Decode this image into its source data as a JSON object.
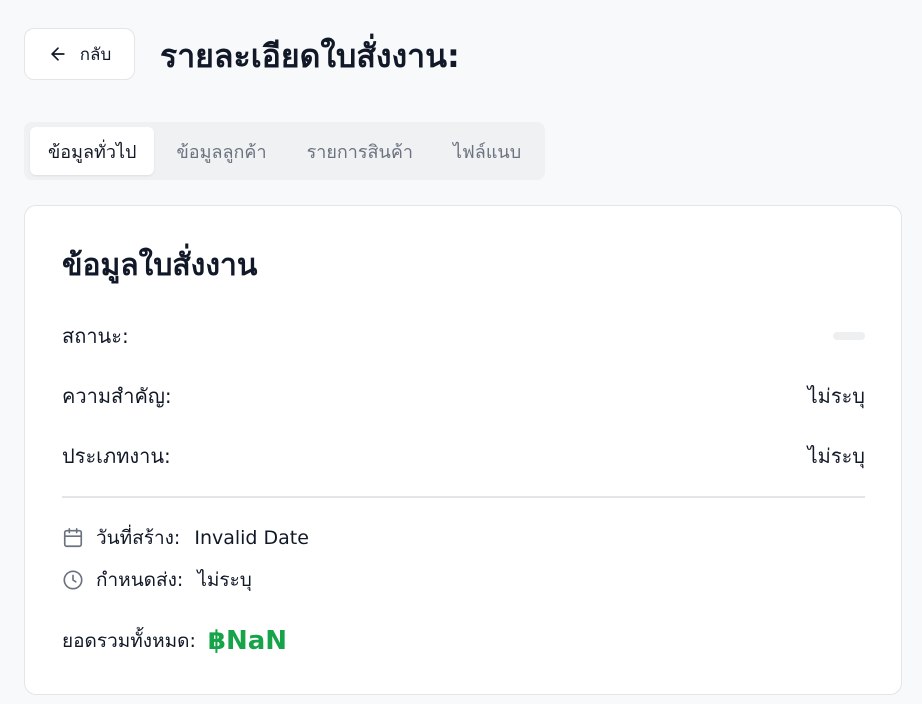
{
  "header": {
    "back_label": "กลับ",
    "title": "รายละเอียดใบสั่งงาน:"
  },
  "tabs": [
    {
      "label": "ข้อมูลทั่วไป",
      "active": true
    },
    {
      "label": "ข้อมูลลูกค้า",
      "active": false
    },
    {
      "label": "รายการสินค้า",
      "active": false
    },
    {
      "label": "ไฟล์แนบ",
      "active": false
    }
  ],
  "card": {
    "title": "ข้อมูลใบสั่งงาน",
    "status_label": "สถานะ:",
    "status_value": "",
    "priority_label": "ความสำคัญ:",
    "priority_value": "ไม่ระบุ",
    "job_type_label": "ประเภทงาน:",
    "job_type_value": "ไม่ระบุ",
    "created_label": "วันที่สร้าง:",
    "created_value": "Invalid Date",
    "due_label": "กำหนดส่ง:",
    "due_value": "ไม่ระบุ",
    "total_label": "ยอดรวมทั้งหมด:",
    "total_value": "฿NaN"
  },
  "icons": {
    "back": "arrow-left-icon",
    "created": "calendar-icon",
    "due": "clock-icon"
  },
  "colors": {
    "background": "#f8f9fb",
    "total_amount": "#16a34a",
    "muted_text": "#6b7280"
  }
}
